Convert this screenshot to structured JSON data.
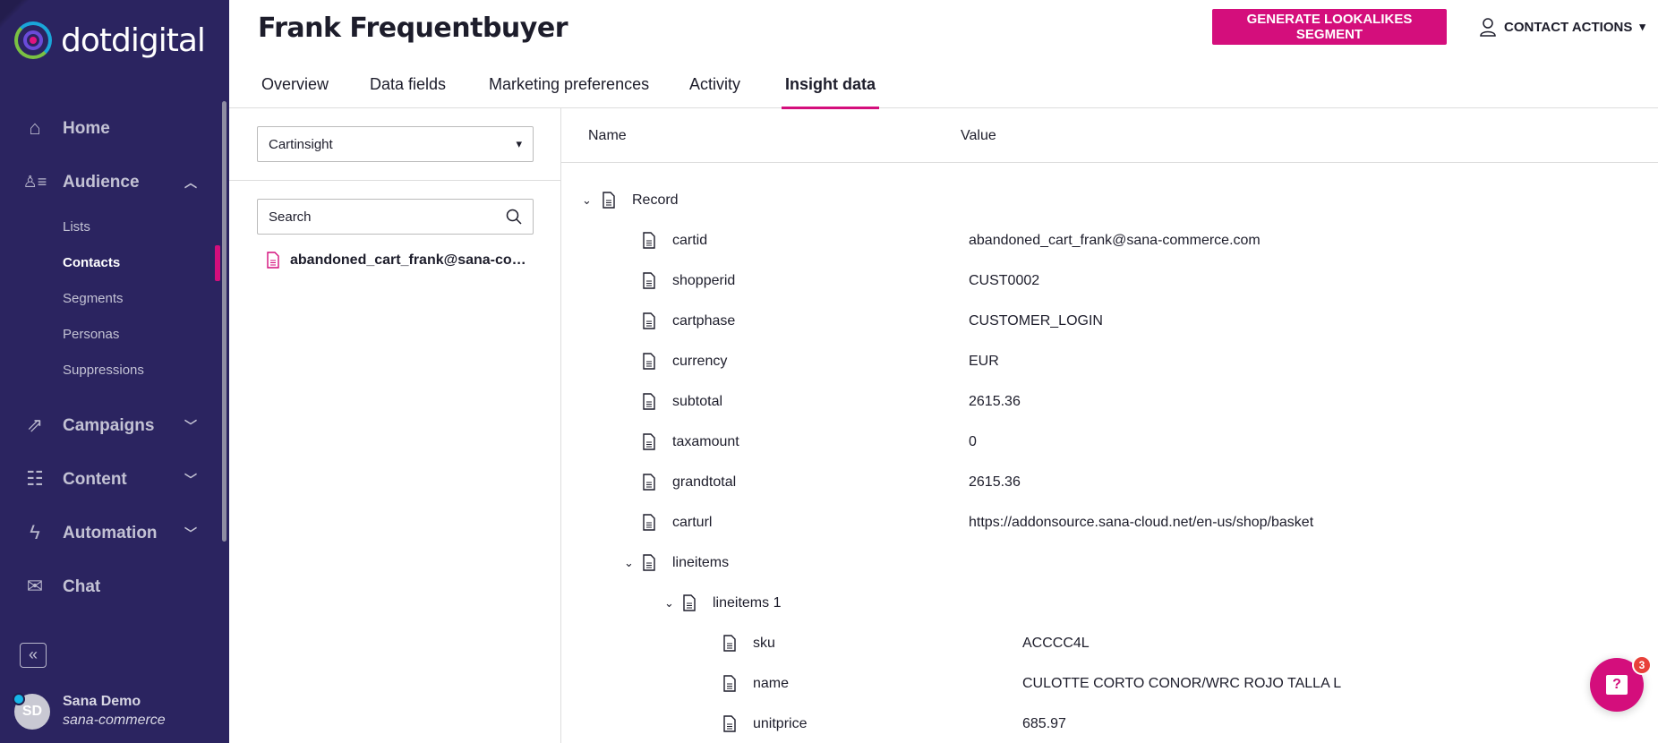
{
  "brand": {
    "name": "dotdigital",
    "accent": "#d40e7c"
  },
  "sidebar": {
    "items": [
      {
        "label": "Home",
        "icon": "home-icon"
      },
      {
        "label": "Audience",
        "icon": "audience-icon",
        "expanded": true
      },
      {
        "label": "Campaigns",
        "icon": "campaigns-icon"
      },
      {
        "label": "Content",
        "icon": "content-icon"
      },
      {
        "label": "Automation",
        "icon": "automation-icon"
      },
      {
        "label": "Chat",
        "icon": "chat-icon"
      }
    ],
    "audience_sub": [
      "Lists",
      "Contacts",
      "Segments",
      "Personas",
      "Suppressions"
    ],
    "active_sub": "Contacts",
    "user": {
      "initials": "SD",
      "name": "Sana Demo",
      "org": "sana-commerce"
    }
  },
  "header": {
    "title": "Frank Frequentbuyer",
    "generate_label": "GENERATE LOOKALIKES SEGMENT",
    "contact_actions_label": "CONTACT ACTIONS"
  },
  "tabs": [
    "Overview",
    "Data fields",
    "Marketing preferences",
    "Activity",
    "Insight data"
  ],
  "active_tab": "Insight data",
  "left": {
    "collection": "Cartinsight",
    "search_placeholder": "Search",
    "record": "abandoned_cart_frank@sana-co…"
  },
  "table": {
    "col_name": "Name",
    "col_value": "Value",
    "rows": [
      {
        "name": "Record",
        "value": "",
        "level": 0,
        "expandable": true
      },
      {
        "name": "cartid",
        "value": "abandoned_cart_frank@sana-commerce.com",
        "level": 1
      },
      {
        "name": "shopperid",
        "value": "CUST0002",
        "level": 1
      },
      {
        "name": "cartphase",
        "value": "CUSTOMER_LOGIN",
        "level": 1
      },
      {
        "name": "currency",
        "value": "EUR",
        "level": 1
      },
      {
        "name": "subtotal",
        "value": "2615.36",
        "level": 1
      },
      {
        "name": "taxamount",
        "value": "0",
        "level": 1
      },
      {
        "name": "grandtotal",
        "value": "2615.36",
        "level": 1
      },
      {
        "name": "carturl",
        "value": "https://addonsource.sana-cloud.net/en-us/shop/basket",
        "level": 1
      },
      {
        "name": "lineitems",
        "value": "",
        "level": 1,
        "expandable": true
      },
      {
        "name": "lineitems 1",
        "value": "",
        "level": 2,
        "expandable": true
      },
      {
        "name": "sku",
        "value": "ACCCC4L",
        "level": 3
      },
      {
        "name": "name",
        "value": "CULOTTE CORTO CONOR/WRC ROJO TALLA L",
        "level": 3
      },
      {
        "name": "unitprice",
        "value": "685.97",
        "level": 3
      }
    ]
  },
  "help": {
    "badge": "3",
    "icon": "help-chat-icon"
  }
}
